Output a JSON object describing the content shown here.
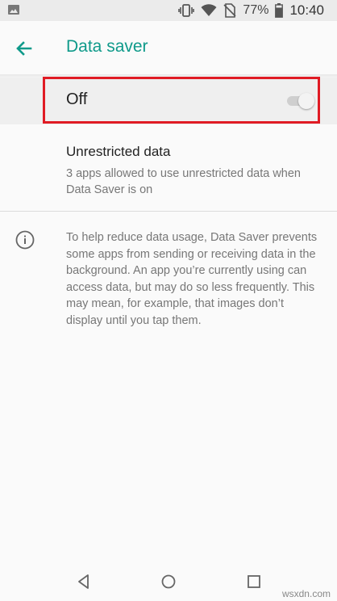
{
  "status_bar": {
    "battery_percent": "77%",
    "time": "10:40",
    "icons": [
      "image-notification-icon",
      "vibrate-icon",
      "wifi-icon",
      "no-sim-icon",
      "battery-icon"
    ]
  },
  "app_bar": {
    "title": "Data saver"
  },
  "toggle": {
    "label": "Off",
    "checked": false
  },
  "unrestricted": {
    "title": "Unrestricted data",
    "subtitle": "3 apps allowed to use unrestricted data when Data Saver is on"
  },
  "info": {
    "text": "To help reduce data usage, Data Saver prevents some apps from sending or receiving data in the background. An app you’re currently using can access data, but may do so less frequently. This may mean, for example, that images don’t display until you tap them."
  },
  "watermark": "wsxdn.com",
  "colors": {
    "accent": "#0f9a8a",
    "highlight": "#e01b24"
  }
}
